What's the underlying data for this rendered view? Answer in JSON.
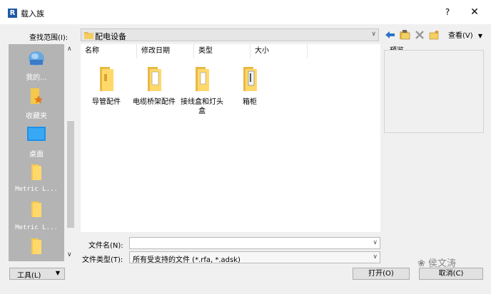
{
  "window": {
    "app_logo": "R",
    "title": "载入族",
    "help_label": "?",
    "close_label": "✕"
  },
  "lookin": {
    "label": "查找范围(I):",
    "value": "配电设备"
  },
  "toolbar": {
    "view_label": "查看(V)"
  },
  "places": [
    {
      "label": "我的...",
      "icon": "computer-icon"
    },
    {
      "label": "收藏夹",
      "icon": "favorites-icon"
    },
    {
      "label": "桌面",
      "icon": "desktop-icon"
    },
    {
      "label": "Metric L...",
      "icon": "folder-icon"
    },
    {
      "label": "Metric L...",
      "icon": "folder-icon"
    }
  ],
  "columns": [
    "名称",
    "修改日期",
    "类型",
    "大小"
  ],
  "files": [
    {
      "name": "导管配件"
    },
    {
      "name": "电缆桥架配件"
    },
    {
      "name": "接线盒和灯头盒"
    },
    {
      "name": "箱柜"
    }
  ],
  "preview": {
    "label": "预览"
  },
  "filename": {
    "label": "文件名(N):",
    "value": ""
  },
  "filetype": {
    "label": "文件类型(T):",
    "value": "所有受支持的文件 (*.rfa, *.adsk)"
  },
  "buttons": {
    "tools": "工具(L)",
    "open": "打开(O)",
    "cancel": "取消(C)"
  },
  "watermark": "侯文涛",
  "colors": {
    "places_bg": "#b4b4b4",
    "folder_yellow": "#f2c94c",
    "logo_blue": "#1f5aa6"
  }
}
